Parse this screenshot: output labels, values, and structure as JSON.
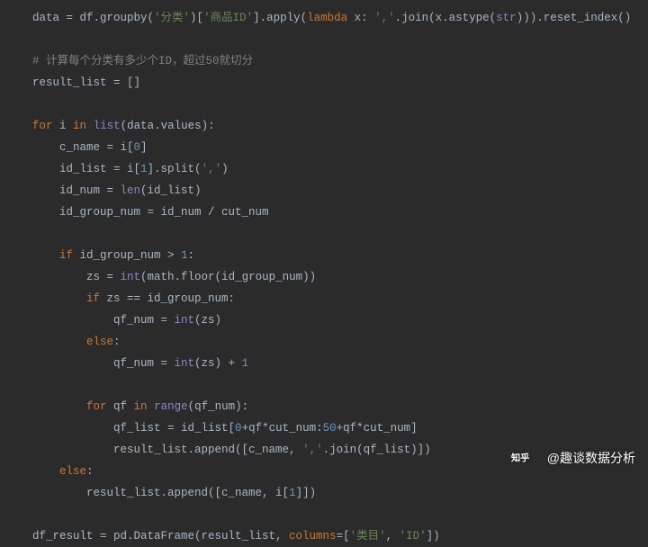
{
  "lines": [
    {
      "indent": 0,
      "tokens": [
        [
          "text",
          "data = df.groupby("
        ],
        [
          "str",
          "'分类'"
        ],
        [
          "text",
          ")["
        ],
        [
          "str",
          "'商品ID'"
        ],
        [
          "text",
          "].apply("
        ],
        [
          "kw",
          "lambda"
        ],
        [
          "text",
          " x: "
        ],
        [
          "str",
          "','"
        ],
        [
          "text",
          ".join(x.astype("
        ],
        [
          "builtin",
          "str"
        ],
        [
          "text",
          "))).reset_index()"
        ]
      ]
    },
    {
      "indent": 0,
      "tokens": []
    },
    {
      "indent": 0,
      "tokens": [
        [
          "comment",
          "# 计算每个分类有多少个ID，超过50就切分"
        ]
      ]
    },
    {
      "indent": 0,
      "tokens": [
        [
          "text",
          "result_list = []"
        ]
      ]
    },
    {
      "indent": 0,
      "tokens": []
    },
    {
      "indent": 0,
      "tokens": [
        [
          "kw",
          "for"
        ],
        [
          "text",
          " i "
        ],
        [
          "kw",
          "in"
        ],
        [
          "text",
          " "
        ],
        [
          "builtin",
          "list"
        ],
        [
          "text",
          "(data.values):"
        ]
      ]
    },
    {
      "indent": 1,
      "tokens": [
        [
          "text",
          "c_name = i["
        ],
        [
          "num",
          "0"
        ],
        [
          "text",
          "]"
        ]
      ]
    },
    {
      "indent": 1,
      "tokens": [
        [
          "text",
          "id_list = i["
        ],
        [
          "num",
          "1"
        ],
        [
          "text",
          "].split("
        ],
        [
          "str",
          "','"
        ],
        [
          "text",
          ")"
        ]
      ]
    },
    {
      "indent": 1,
      "tokens": [
        [
          "text",
          "id_num = "
        ],
        [
          "builtin",
          "len"
        ],
        [
          "text",
          "(id_list)"
        ]
      ]
    },
    {
      "indent": 1,
      "tokens": [
        [
          "text",
          "id_group_num = id_num / cut_num"
        ]
      ]
    },
    {
      "indent": 1,
      "tokens": []
    },
    {
      "indent": 1,
      "tokens": [
        [
          "kw",
          "if"
        ],
        [
          "text",
          " id_group_num > "
        ],
        [
          "num",
          "1"
        ],
        [
          "text",
          ":"
        ]
      ]
    },
    {
      "indent": 2,
      "tokens": [
        [
          "text",
          "zs = "
        ],
        [
          "builtin",
          "int"
        ],
        [
          "text",
          "(math.floor(id_group_num))"
        ]
      ]
    },
    {
      "indent": 2,
      "tokens": [
        [
          "kw",
          "if"
        ],
        [
          "text",
          " zs == id_group_num:"
        ]
      ]
    },
    {
      "indent": 3,
      "tokens": [
        [
          "text",
          "qf_num = "
        ],
        [
          "builtin",
          "int"
        ],
        [
          "text",
          "(zs)"
        ]
      ]
    },
    {
      "indent": 2,
      "tokens": [
        [
          "kw",
          "else"
        ],
        [
          "text",
          ":"
        ]
      ]
    },
    {
      "indent": 3,
      "tokens": [
        [
          "text",
          "qf_num = "
        ],
        [
          "builtin",
          "int"
        ],
        [
          "text",
          "(zs) + "
        ],
        [
          "num",
          "1"
        ]
      ]
    },
    {
      "indent": 2,
      "tokens": []
    },
    {
      "indent": 2,
      "tokens": [
        [
          "kw",
          "for"
        ],
        [
          "text",
          " qf "
        ],
        [
          "kw",
          "in"
        ],
        [
          "text",
          " "
        ],
        [
          "builtin",
          "range"
        ],
        [
          "text",
          "(qf_num):"
        ]
      ]
    },
    {
      "indent": 3,
      "tokens": [
        [
          "text",
          "qf_list = id_list["
        ],
        [
          "num",
          "0"
        ],
        [
          "text",
          "+qf*cut_num:"
        ],
        [
          "num",
          "50"
        ],
        [
          "text",
          "+qf*cut_num]"
        ]
      ]
    },
    {
      "indent": 3,
      "tokens": [
        [
          "text",
          "result_list.append([c_name, "
        ],
        [
          "str",
          "','"
        ],
        [
          "text",
          ".join(qf_list)])"
        ]
      ]
    },
    {
      "indent": 1,
      "tokens": [
        [
          "kw",
          "else"
        ],
        [
          "text",
          ":"
        ]
      ]
    },
    {
      "indent": 2,
      "tokens": [
        [
          "text",
          "result_list.append([c_name, i["
        ],
        [
          "num",
          "1"
        ],
        [
          "text",
          "]])"
        ]
      ]
    },
    {
      "indent": 0,
      "tokens": []
    },
    {
      "indent": 0,
      "tokens": [
        [
          "text",
          "df_result = pd.DataFrame(result_list, "
        ],
        [
          "param",
          "columns"
        ],
        [
          "text",
          "=["
        ],
        [
          "str",
          "'类目'"
        ],
        [
          "text",
          ", "
        ],
        [
          "str",
          "'ID'"
        ],
        [
          "text",
          "])"
        ]
      ]
    }
  ],
  "watermark": {
    "brand": "知乎",
    "author": "@趣谈数据分析"
  }
}
